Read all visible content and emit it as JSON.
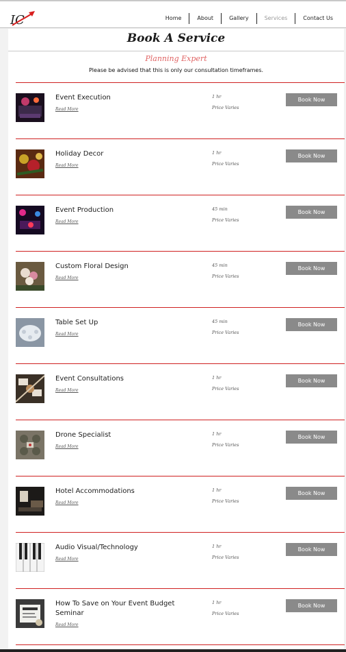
{
  "logo": {
    "text": "IC"
  },
  "nav": [
    {
      "label": "Home"
    },
    {
      "label": "About"
    },
    {
      "label": "Gallery"
    },
    {
      "label": "Services",
      "active": true
    },
    {
      "label": "Contact Us"
    }
  ],
  "page": {
    "title": "Book A Service",
    "subtitle": "Planning Expert",
    "notice": "Please be advised that this is only our consultation timeframes."
  },
  "services": [
    {
      "name": "Event Execution",
      "read_more": "Read More",
      "duration": "1 hr",
      "price": "Price Varies",
      "book_label": "Book Now",
      "thumb": "event-execution"
    },
    {
      "name": "Holiday Decor",
      "read_more": "Read More",
      "duration": "1 hr",
      "price": "Price Varies",
      "book_label": "Book Now",
      "thumb": "holiday-decor"
    },
    {
      "name": "Event Production",
      "read_more": "Read More",
      "duration": "45 min",
      "price": "Price Varies",
      "book_label": "Book Now",
      "thumb": "event-production"
    },
    {
      "name": "Custom Floral Design",
      "read_more": "Read More",
      "duration": "45 min",
      "price": "Price Varies",
      "book_label": "Book Now",
      "thumb": "custom-floral"
    },
    {
      "name": "Table Set Up",
      "read_more": "Read More",
      "duration": "45 min",
      "price": "Price Varies",
      "book_label": "Book Now",
      "thumb": "table-setup"
    },
    {
      "name": "Event Consultations",
      "read_more": "Read More",
      "duration": "1 hr",
      "price": "Price Varies",
      "book_label": "Book Now",
      "thumb": "consultations"
    },
    {
      "name": "Drone Specialist",
      "read_more": "Read More",
      "duration": "1 hr",
      "price": "Price Varies",
      "book_label": "Book Now",
      "thumb": "drone"
    },
    {
      "name": "Hotel Accommodations",
      "read_more": "Read More",
      "duration": "1 hr",
      "price": "Price Varies",
      "book_label": "Book Now",
      "thumb": "hotel"
    },
    {
      "name": "Audio Visual/Technology",
      "read_more": "Read More",
      "duration": "1 hr",
      "price": "Price Varies",
      "book_label": "Book Now",
      "thumb": "audio-visual"
    },
    {
      "name": "How To Save on Your Event Budget Seminar",
      "read_more": "Read More",
      "duration": "1 hr",
      "price": "Price Varies",
      "book_label": "Book Now",
      "thumb": "budget-seminar"
    }
  ]
}
